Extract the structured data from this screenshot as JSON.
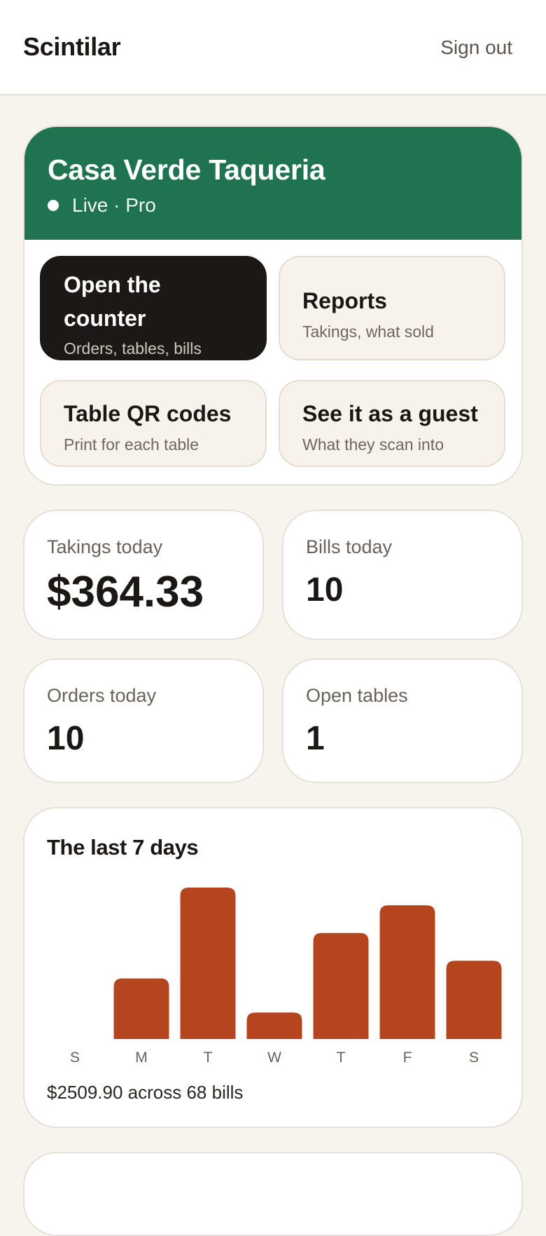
{
  "header": {
    "brand": "Scintilar",
    "sign_out_label": "Sign out"
  },
  "venue": {
    "name": "Casa Verde Taqueria",
    "status": "Live · Pro",
    "brand_color": "#1f7350"
  },
  "actions": [
    {
      "title": "Open the counter",
      "subtitle": "Orders, tables, bills"
    },
    {
      "title": "Reports",
      "subtitle": "Takings, what sold"
    },
    {
      "title": "Table QR codes",
      "subtitle": "Print for each table"
    },
    {
      "title": "See it as a guest",
      "subtitle": "What they scan into"
    }
  ],
  "stats": {
    "takings_today": {
      "label": "Takings today",
      "value": "$364.33"
    },
    "bills_today": {
      "label": "Bills today",
      "value": "10"
    },
    "orders_today": {
      "label": "Orders today",
      "value": "10"
    },
    "open_tables": {
      "label": "Open tables",
      "value": "1"
    }
  },
  "chart_data": {
    "type": "bar",
    "title": "The last 7 days",
    "categories": [
      "S",
      "M",
      "T",
      "W",
      "T",
      "F",
      "S"
    ],
    "values": [
      0,
      240,
      600,
      105,
      420,
      530,
      310
    ],
    "bar_color": "#b5451f",
    "grid": false,
    "footer": "$2509.90 across 68 bills"
  }
}
